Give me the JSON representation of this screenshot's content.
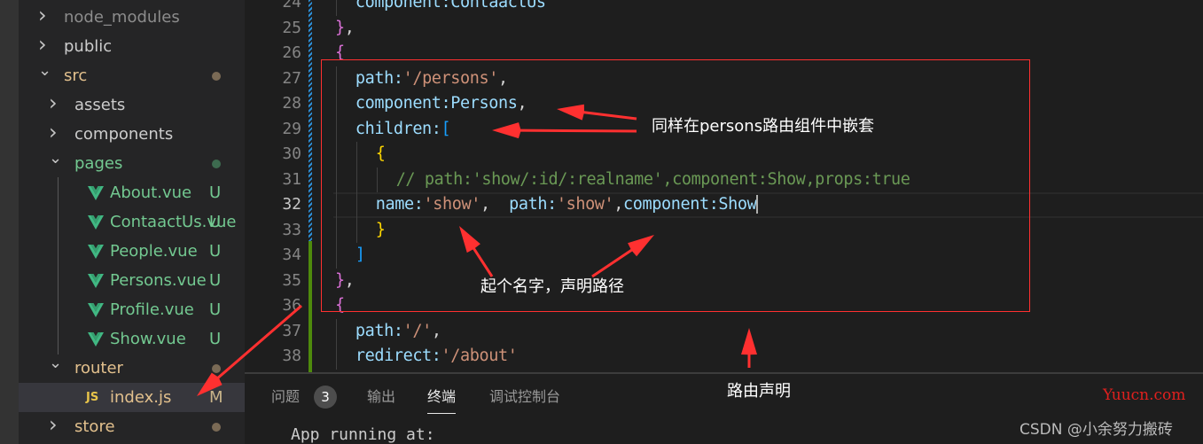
{
  "explorer": {
    "items": [
      {
        "label": "node_modules",
        "type": "folder",
        "open": false,
        "depth": 0,
        "color": "#8c8c8c"
      },
      {
        "label": "public",
        "type": "folder",
        "open": false,
        "depth": 0,
        "color": "#cccccc"
      },
      {
        "label": "src",
        "type": "folder",
        "open": true,
        "depth": 0,
        "color": "#e2c08d",
        "dot": "#7a6a55"
      },
      {
        "label": "assets",
        "type": "folder",
        "open": false,
        "depth": 1,
        "color": "#cccccc"
      },
      {
        "label": "components",
        "type": "folder",
        "open": false,
        "depth": 1,
        "color": "#cccccc"
      },
      {
        "label": "pages",
        "type": "folder",
        "open": true,
        "depth": 1,
        "color": "#73c991",
        "dot": "#3d6b4f"
      },
      {
        "label": "About.vue",
        "type": "vue",
        "depth": 2,
        "color": "#73c991",
        "badge": "U"
      },
      {
        "label": "ContaactUs.vue",
        "type": "vue",
        "depth": 2,
        "color": "#73c991",
        "badge": "U"
      },
      {
        "label": "People.vue",
        "type": "vue",
        "depth": 2,
        "color": "#73c991",
        "badge": "U"
      },
      {
        "label": "Persons.vue",
        "type": "vue",
        "depth": 2,
        "color": "#73c991",
        "badge": "U"
      },
      {
        "label": "Profile.vue",
        "type": "vue",
        "depth": 2,
        "color": "#73c991",
        "badge": "U"
      },
      {
        "label": "Show.vue",
        "type": "vue",
        "depth": 2,
        "color": "#73c991",
        "badge": "U"
      },
      {
        "label": "router",
        "type": "folder",
        "open": true,
        "depth": 1,
        "color": "#e2c08d",
        "dot": "#7a6a55"
      },
      {
        "label": "index.js",
        "type": "js",
        "depth": 2,
        "color": "#e2c08d",
        "badge": "M",
        "selected": true,
        "icon_text": "JS"
      },
      {
        "label": "store",
        "type": "folder",
        "open": false,
        "depth": 1,
        "color": "#e2c08d",
        "dot": "#7a6a55"
      }
    ]
  },
  "editor": {
    "current_line": 32,
    "lines": [
      {
        "n": 24,
        "indent": 1,
        "tokens": [
          [
            "component:ContaactUs",
            "#9cdcfe"
          ]
        ]
      },
      {
        "n": 25,
        "indent": 0,
        "tokens": [
          [
            "}",
            "#da70d6"
          ],
          [
            ",",
            "#d4d4d4"
          ]
        ]
      },
      {
        "n": 26,
        "indent": 0,
        "tokens": [
          [
            "{",
            "#da70d6"
          ]
        ]
      },
      {
        "n": 27,
        "indent": 1,
        "tokens": [
          [
            "path:",
            "#9cdcfe"
          ],
          [
            "'/persons'",
            "#ce9178"
          ],
          [
            ",",
            "#d4d4d4"
          ]
        ]
      },
      {
        "n": 28,
        "indent": 1,
        "tokens": [
          [
            "component:Persons",
            "#9cdcfe"
          ],
          [
            ",",
            "#d4d4d4"
          ]
        ]
      },
      {
        "n": 29,
        "indent": 1,
        "tokens": [
          [
            "children:",
            "#9cdcfe"
          ],
          [
            "[",
            "#179fff"
          ]
        ]
      },
      {
        "n": 30,
        "indent": 2,
        "tokens": [
          [
            "{",
            "#ffd700"
          ]
        ]
      },
      {
        "n": 31,
        "indent": 3,
        "tokens": [
          [
            "// path:'show/:id/:realname',component:Show,props:true",
            "#6a9955"
          ]
        ]
      },
      {
        "n": 32,
        "indent": 2,
        "tokens": [
          [
            "name:",
            "#9cdcfe"
          ],
          [
            "'show'",
            "#ce9178"
          ],
          [
            ",  ",
            "#d4d4d4"
          ],
          [
            "path:",
            "#9cdcfe"
          ],
          [
            "'show'",
            "#ce9178"
          ],
          [
            ",",
            "#d4d4d4"
          ],
          [
            "component:Show",
            "#9cdcfe"
          ]
        ]
      },
      {
        "n": 33,
        "indent": 2,
        "tokens": [
          [
            "}",
            "#ffd700"
          ]
        ]
      },
      {
        "n": 34,
        "indent": 1,
        "tokens": [
          [
            "]",
            "#179fff"
          ]
        ]
      },
      {
        "n": 35,
        "indent": 0,
        "tokens": [
          [
            "}",
            "#da70d6"
          ],
          [
            ",",
            "#d4d4d4"
          ]
        ]
      },
      {
        "n": 36,
        "indent": 0,
        "tokens": [
          [
            "{",
            "#da70d6"
          ]
        ]
      },
      {
        "n": 37,
        "indent": 1,
        "tokens": [
          [
            "path:",
            "#9cdcfe"
          ],
          [
            "'/'",
            "#ce9178"
          ],
          [
            ",",
            "#d4d4d4"
          ]
        ]
      },
      {
        "n": 38,
        "indent": 1,
        "tokens": [
          [
            "redirect:",
            "#9cdcfe"
          ],
          [
            "'/about'",
            "#ce9178"
          ]
        ]
      }
    ]
  },
  "panel": {
    "tabs": [
      {
        "label": "问题",
        "count": "3"
      },
      {
        "label": "输出"
      },
      {
        "label": "终端",
        "active": true
      },
      {
        "label": "调试控制台"
      }
    ],
    "terminal_text": "App running at:"
  },
  "annotations": {
    "nested": "同样在persons路由组件中嵌套",
    "name_path": "起个名字，声明路径",
    "route_decl": "路由声明",
    "color": "#ff3030"
  },
  "watermarks": {
    "site": "Yuucn.com",
    "author": "CSDN @小余努力搬砖"
  }
}
